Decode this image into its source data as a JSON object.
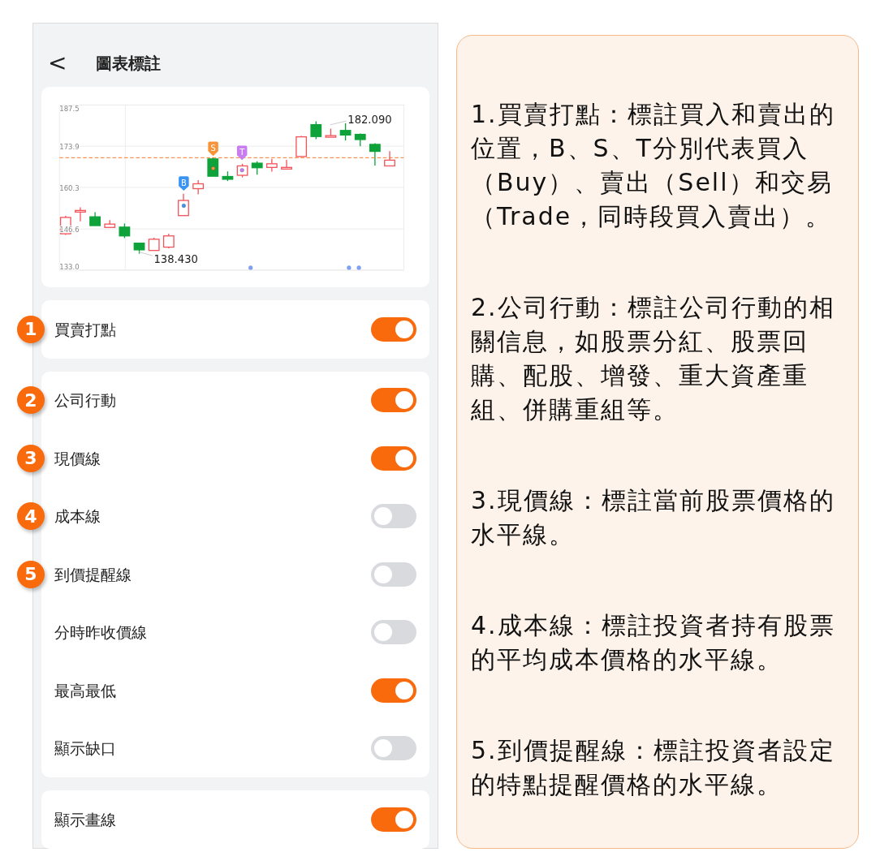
{
  "header": {
    "back": "<",
    "title": "圖表標註"
  },
  "chart": {
    "high_label": "182.090",
    "low_label": "138.430",
    "chart_data": {
      "type": "candlestick",
      "grid": true,
      "ref_lines": [
        {
          "axis": "y",
          "value": 170.1,
          "color": "#f97a2e"
        }
      ],
      "ohlc": [
        [
          145.0,
          150.9,
          144.6,
          150.4
        ],
        [
          152.2,
          153.7,
          149.1,
          152.7
        ],
        [
          150.6,
          152.1,
          147.7,
          147.7
        ],
        [
          147.1,
          149.5,
          147.1,
          148.2
        ],
        [
          147.2,
          148.4,
          143.6,
          144.3
        ],
        [
          141.9,
          142.1,
          138.43,
          139.7
        ],
        [
          139.5,
          143.7,
          139.5,
          143.2
        ],
        [
          140.6,
          145.0,
          140.2,
          144.3
        ],
        [
          151.0,
          158.2,
          151.0,
          156.0
        ],
        [
          159.9,
          162.7,
          158.0,
          161.5
        ],
        [
          169.7,
          170.2,
          164.0,
          164.0
        ],
        [
          163.9,
          165.6,
          162.4,
          163.0
        ],
        [
          164.3,
          168.1,
          163.6,
          167.4
        ],
        [
          168.3,
          168.9,
          164.5,
          166.8
        ],
        [
          166.9,
          169.7,
          165.5,
          168.1
        ],
        [
          166.5,
          169.4,
          166.5,
          166.9
        ],
        [
          170.5,
          177.3,
          170.5,
          177.0
        ],
        [
          181.0,
          182.09,
          176.2,
          177.1
        ],
        [
          176.9,
          179.7,
          176.9,
          177.4
        ],
        [
          179.1,
          181.5,
          175.8,
          177.6
        ],
        [
          177.8,
          178.1,
          173.9,
          176.1
        ],
        [
          174.5,
          174.9,
          167.5,
          172.2
        ],
        [
          167.4,
          172.3,
          167.4,
          169.3
        ]
      ],
      "ylim": [
        133.0,
        187.5
      ],
      "yticks": [
        {
          "value": 187.5,
          "label": "187.5"
        },
        {
          "value": 173.9,
          "label": "173.9"
        },
        {
          "value": 160.3,
          "label": "160.3"
        },
        {
          "value": 146.6,
          "label": "146.6"
        },
        {
          "value": 133.0,
          "label": "133.0"
        }
      ]
    },
    "markers": [
      {
        "label": "B",
        "color": "#3a94f5"
      },
      {
        "label": "S",
        "color": "#f7943a"
      },
      {
        "label": "T",
        "color": "#c87cf0"
      }
    ]
  },
  "groups": [
    {
      "items": [
        {
          "badge": "1",
          "label": "買賣打點",
          "on": true
        }
      ]
    },
    {
      "items": [
        {
          "badge": "2",
          "label": "公司行動",
          "on": true
        },
        {
          "badge": "3",
          "label": "現價線",
          "on": true
        },
        {
          "badge": "4",
          "label": "成本線",
          "on": false
        },
        {
          "badge": "5",
          "label": "到價提醒線",
          "on": false
        },
        {
          "label": "分時昨收價線",
          "on": false
        },
        {
          "label": "最高最低",
          "on": true
        },
        {
          "label": "顯示缺口",
          "on": false
        }
      ]
    },
    {
      "items": [
        {
          "label": "顯示畫線",
          "on": true
        }
      ]
    }
  ],
  "notes": [
    "1.買賣打點：標註買入和賣出的位置，B、S、T分別代表買入（Buy）、賣出（Sell）和交易（Trade，同時段買入賣出）。",
    "2.公司行動：標註公司行動的相關信息，如股票分紅、股票回購、配股、增發、重大資產重組、併購重組等。",
    "3.現價線：標註當前股票價格的水平線。",
    "4.成本線：標註投資者持有股票的平均成本價格的水平線。",
    "5.到價提醒線：標註投資者設定的特點提醒價格的水平線。"
  ]
}
